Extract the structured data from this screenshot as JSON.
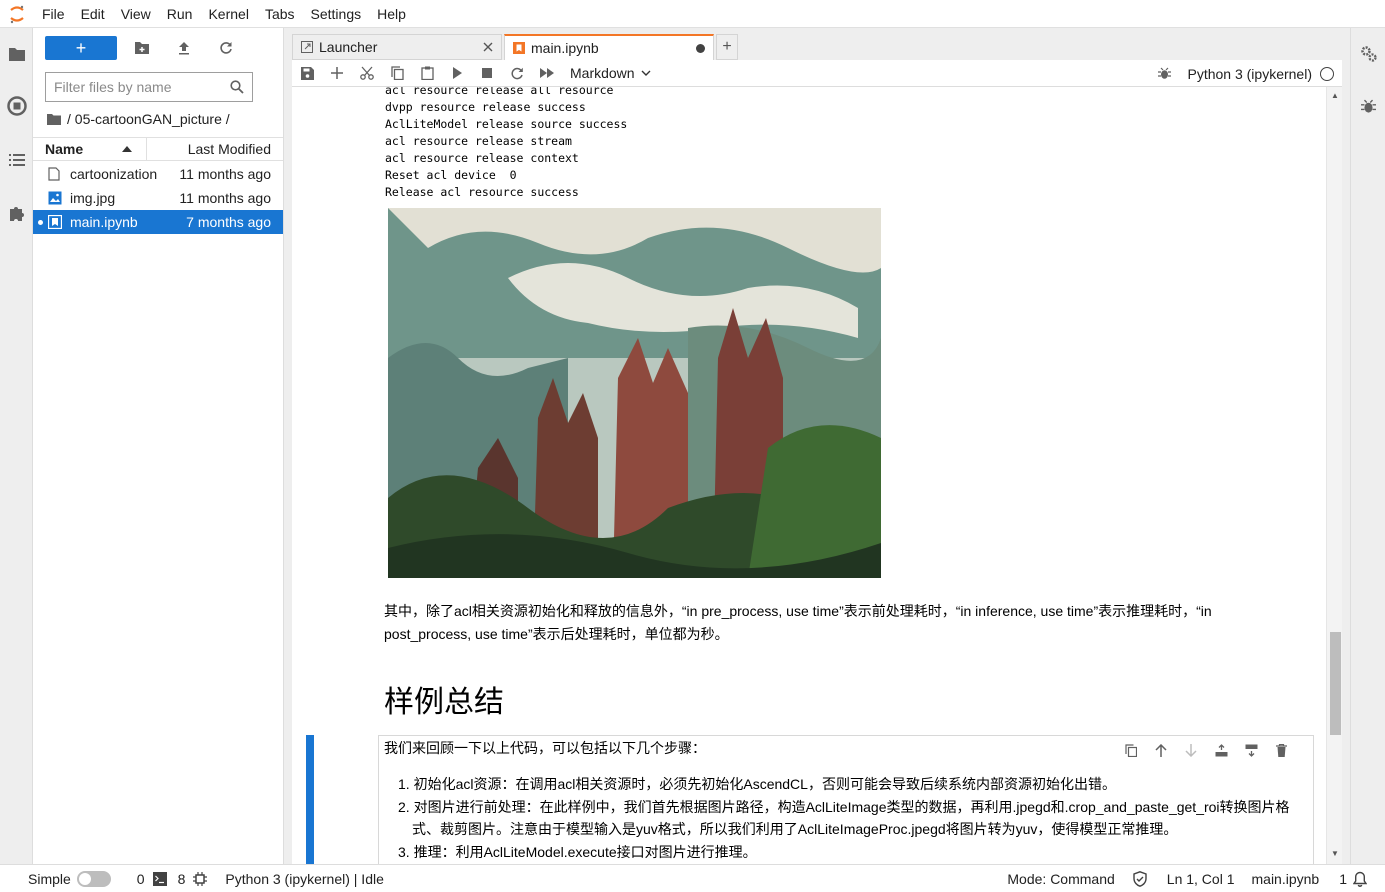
{
  "menu": [
    "File",
    "Edit",
    "View",
    "Run",
    "Kernel",
    "Tabs",
    "Settings",
    "Help"
  ],
  "filebrowser": {
    "new_label": "+",
    "search_placeholder": "Filter files by name",
    "breadcrumb": "/ 05-cartoonGAN_picture /",
    "col_name": "Name",
    "col_modified": "Last Modified",
    "files": [
      {
        "name": "cartoonization",
        "modified": "11 months ago",
        "icon": "folder-outline-icon"
      },
      {
        "name": "img.jpg",
        "modified": "11 months ago",
        "icon": "image-icon"
      },
      {
        "name": "main.ipynb",
        "modified": "7 months ago",
        "icon": "notebook-icon",
        "selected": true
      }
    ]
  },
  "tabs": [
    {
      "label": "Launcher",
      "icon": "launcher-icon"
    },
    {
      "label": "main.ipynb",
      "icon": "notebook-icon",
      "active": true
    }
  ],
  "toolbar": {
    "cell_type": "Markdown",
    "kernel": "Python 3 (ipykernel)"
  },
  "notebook": {
    "output_lines": [
      "acl resource release all resource",
      "dvpp resource release success",
      "AclLiteModel release source success",
      "acl resource release stream",
      "acl resource release context",
      "Reset acl device  0",
      "Release acl resource success"
    ],
    "paragraph": "其中，除了acl相关资源初始化和释放的信息外，“in pre_process, use time”表示前处理耗时，“in inference, use time”表示推理耗时，“in post_process, use time”表示后处理耗时，单位都为秒。",
    "heading": "样例总结",
    "cell_intro": "我们来回顾一下以上代码，可以包括以下几个步骤：",
    "steps": [
      "1. 初始化acl资源：在调用acl相关资源时，必须先初始化AscendCL，否则可能会导致后续系统内部资源初始化出错。",
      "2. 对图片进行前处理：在此样例中，我们首先根据图片路径，构造AclLiteImage类型的数据，再利用.jpegd和.crop_and_paste_get_roi转换图片格式、裁剪图片。注意由于模型输入是yuv格式，所以我们利用了AclLiteImageProc.jpegd将图片转为yuv，使得模型正常推理。",
      "3. 推理：利用AclLiteModel.execute接口对图片进行推理。"
    ]
  },
  "statusbar": {
    "mode_simple": "Simple",
    "terminals": "0",
    "kernels": "8",
    "kernel_status": "Python 3 (ipykernel) | Idle",
    "mode": "Mode: Command",
    "position": "Ln 1, Col 1",
    "file": "main.ipynb",
    "notifications": "1"
  },
  "colors": {
    "accent": "#1976d2",
    "jupyter_orange": "#f37626"
  }
}
